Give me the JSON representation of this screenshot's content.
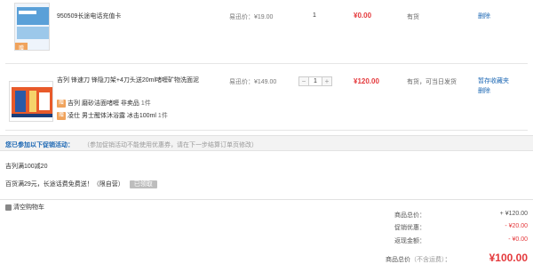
{
  "cart": {
    "items": [
      {
        "name": "950509长途电话充值卡",
        "price_label": "易迅价：¥19.00",
        "qty": "1",
        "total": "¥0.00",
        "stock": "有货",
        "ops": [
          "删除"
        ],
        "thumb_tag": "赠"
      },
      {
        "name": "吉列 锋速刀 锋隐刀架+4刀头送20ml啫喱矿物洗面泥",
        "price_label": "易迅价：¥149.00",
        "qty": "1",
        "qty_minus": "−",
        "qty_plus": "+",
        "total": "¥120.00",
        "stock": "有货，可当日发货",
        "ops": [
          "暂存收藏夹",
          "删除"
        ],
        "gifts": [
          {
            "tag": "赠",
            "text": "吉列 磨砂洁面啫喱 非卖品",
            "count": "1件"
          },
          {
            "tag": "赠",
            "text": "凌仕 男士醒体沐浴露 冰击100ml",
            "count": "1件"
          }
        ]
      }
    ]
  },
  "promo": {
    "title": "您已参加以下促销活动：",
    "note": "（参加促销活动不能使用优惠券，请在下一步结算订单页修改）",
    "items": [
      {
        "text": "吉列满100减20"
      },
      {
        "text": "百货满29元，长途话费免费送！（限自营）",
        "badge": "已领取"
      }
    ]
  },
  "footer": {
    "clear_cart": "清空购物车"
  },
  "summary": {
    "rows": [
      {
        "label": "商品总价：",
        "value": "+ ¥120.00"
      },
      {
        "label": "促销优惠：",
        "value": "- ¥20.00"
      },
      {
        "label": "返现金额：",
        "value": "- ¥0.00"
      }
    ],
    "grand_label": "商品总价",
    "grand_note": "（不含运费）",
    "grand_colon": "：",
    "grand_value": "¥100.00"
  },
  "colors": {
    "accent_red": "#e4393c",
    "link_blue": "#1a66b3",
    "gift_tag": "#f0a35c"
  }
}
